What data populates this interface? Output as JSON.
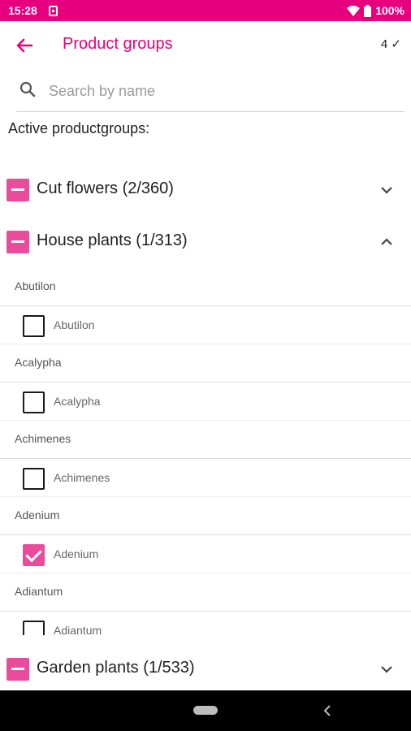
{
  "status_bar": {
    "time": "15:28",
    "battery": "100%"
  },
  "header": {
    "title": "Product groups",
    "count": "4 ✓"
  },
  "search": {
    "placeholder": "Search by name"
  },
  "section_label": "Active productgroups:",
  "groups": [
    {
      "label": "Cut flowers (2/360)",
      "state": "collapsed"
    },
    {
      "label": "House plants (1/313)",
      "state": "expanded"
    },
    {
      "label": "Garden plants (1/533)",
      "state": "collapsed"
    }
  ],
  "house_plants_items": [
    {
      "header": "Abutilon",
      "name": "Abutilon",
      "checked": false
    },
    {
      "header": "Acalypha",
      "name": "Acalypha",
      "checked": false
    },
    {
      "header": "Achimenes",
      "name": "Achimenes",
      "checked": false
    },
    {
      "header": "Adenium",
      "name": "Adenium",
      "checked": true
    },
    {
      "header": "Adiantum",
      "name": "Adiantum",
      "checked": false
    }
  ],
  "colors": {
    "accent": "#e6007e",
    "checkbox_fill": "#ea4c9b"
  }
}
